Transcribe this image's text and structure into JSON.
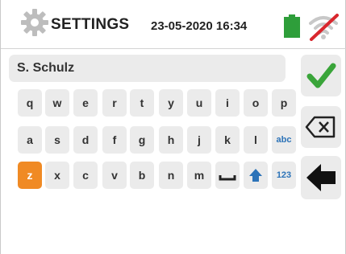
{
  "header": {
    "title": "SETTINGS",
    "datetime": "23-05-2020  16:34",
    "icons": {
      "settings": "gear-icon",
      "battery": "battery-icon",
      "wifi": "wifi-off-icon"
    },
    "colors": {
      "battery": "#2e9e3a",
      "wifi_off": "#d9272e"
    }
  },
  "input": {
    "value": "S. Schulz"
  },
  "keyboard": {
    "row1": [
      "q",
      "w",
      "e",
      "r",
      "t",
      "y",
      "u",
      "i",
      "o",
      "p"
    ],
    "row2": [
      "a",
      "s",
      "d",
      "f",
      "g",
      "h",
      "j",
      "k",
      "l",
      "abc"
    ],
    "row3": [
      "z",
      "x",
      "c",
      "v",
      "b",
      "n",
      "m"
    ],
    "row3_mode": "123",
    "active_key": "z",
    "icons": {
      "space": "space-bar-icon",
      "shift": "shift-arrow-icon"
    }
  },
  "side_buttons": {
    "icons": [
      "checkmark-icon",
      "backspace-icon",
      "back-arrow-icon"
    ],
    "colors": {
      "confirm": "#3aa53a",
      "accent": "#f08a24",
      "mode_text": "#2c73b8"
    }
  }
}
